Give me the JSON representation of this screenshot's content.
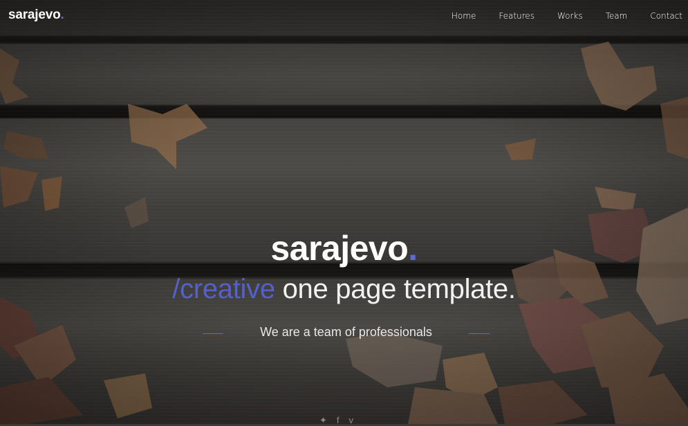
{
  "brand": {
    "name": "sarajevo",
    "dot": "."
  },
  "nav": {
    "items": [
      "Home",
      "Features",
      "Works",
      "Team",
      "Contact"
    ]
  },
  "hero": {
    "title": "sarajevo",
    "title_dot": ".",
    "tagline_accent": "/creative",
    "tagline_rest": " one page template.",
    "subtitle": "We are a team of professionals"
  },
  "social": {
    "icons": [
      "twitter-icon",
      "facebook-icon",
      "vimeo-icon"
    ],
    "glyphs": [
      "✦",
      "f",
      "v"
    ]
  },
  "colors": {
    "accent": "#5b6bd6",
    "text": "#ffffff"
  }
}
